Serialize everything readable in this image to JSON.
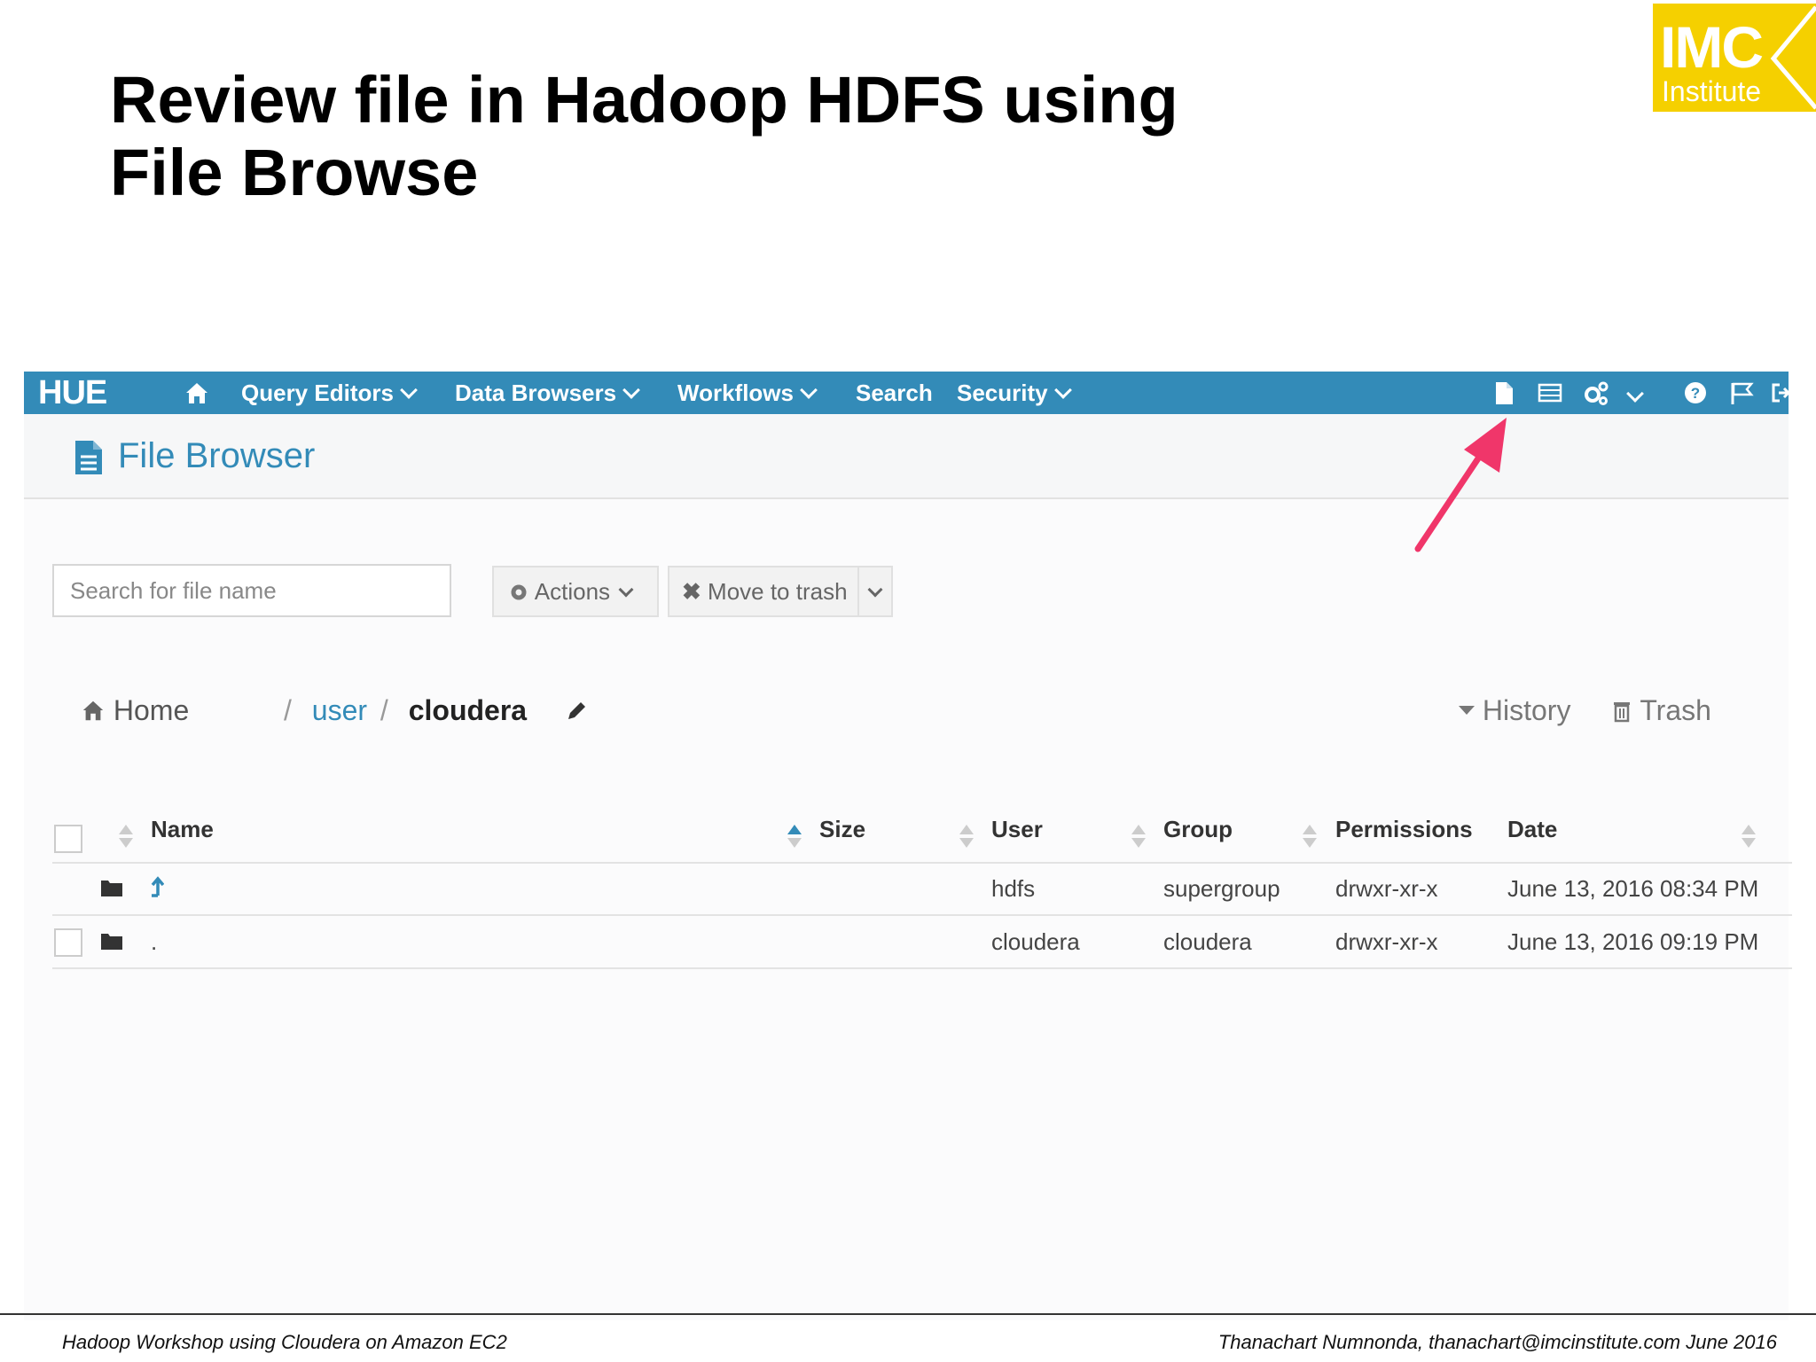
{
  "slide": {
    "title_line1": "Review file in Hadoop HDFS using",
    "title_line2": "File Browse",
    "logo_big": "IMC",
    "logo_small": "Institute",
    "footer_left": "Hadoop Workshop using Cloudera on Amazon EC2",
    "footer_right": "Thanachart Numnonda,  thanachart@imcinstitute.com  June 2016"
  },
  "navbar": {
    "logo": "HUE",
    "items": [
      {
        "label": "Query Editors"
      },
      {
        "label": "Data Browsers"
      },
      {
        "label": "Workflows"
      },
      {
        "label": "Search"
      },
      {
        "label": "Security"
      }
    ],
    "icons": [
      "home-icon",
      "file-icon",
      "table-icon",
      "cogs-icon",
      "help-icon",
      "flag-icon",
      "logout-icon"
    ],
    "color": "#338bb8"
  },
  "page": {
    "title": "File Browser",
    "title_color": "#338bb8"
  },
  "toolbar": {
    "search_placeholder": "Search for file name",
    "actions_label": "Actions",
    "move_to_trash_label": "Move to trash"
  },
  "breadcrumb": {
    "home": "Home",
    "sep1": "/",
    "user": "user",
    "sep2": "/",
    "current": "cloudera",
    "history": "History",
    "trash": "Trash"
  },
  "table": {
    "columns": [
      "Name",
      "Size",
      "User",
      "Group",
      "Permissions",
      "Date"
    ],
    "rows": [
      {
        "name": "",
        "size": "",
        "user": "hdfs",
        "group": "supergroup",
        "permissions": "drwxr-xr-x",
        "date": "June 13, 2016 08:34 PM"
      },
      {
        "name": ".",
        "size": "",
        "user": "cloudera",
        "group": "cloudera",
        "permissions": "drwxr-xr-x",
        "date": "June 13, 2016 09:19 PM"
      }
    ]
  },
  "annotation": {
    "arrow_color": "#f0366a"
  }
}
